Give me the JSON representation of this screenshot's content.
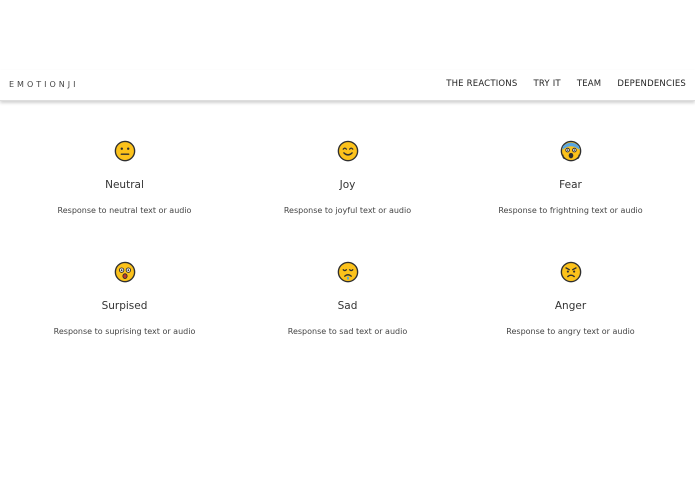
{
  "brand": "EMOTIONJI",
  "nav": {
    "items": [
      {
        "label": "THE REACTIONS"
      },
      {
        "label": "TRY IT"
      },
      {
        "label": "TEAM"
      },
      {
        "label": "DEPENDENCIES"
      }
    ]
  },
  "cards": [
    {
      "title": "Neutral",
      "description": "Response to neutral text or audio",
      "icon": "neutral-face-icon"
    },
    {
      "title": "Joy",
      "description": "Response to joyful text or audio",
      "icon": "smiling-face-icon"
    },
    {
      "title": "Fear",
      "description": "Response to frightning text or audio",
      "icon": "screaming-fear-face-icon"
    },
    {
      "title": "Surpised",
      "description": "Response to suprising text or audio",
      "icon": "astonished-face-icon"
    },
    {
      "title": "Sad",
      "description": "Response to sad text or audio",
      "icon": "crying-face-icon"
    },
    {
      "title": "Anger",
      "description": "Response to angry text or audio",
      "icon": "angry-face-icon"
    }
  ],
  "colors": {
    "emoji_fill": "#FCC21B",
    "emoji_stroke": "#2F2F2F",
    "fear_blue": "#5AA6E0",
    "tear_blue": "#4AA3DF"
  }
}
